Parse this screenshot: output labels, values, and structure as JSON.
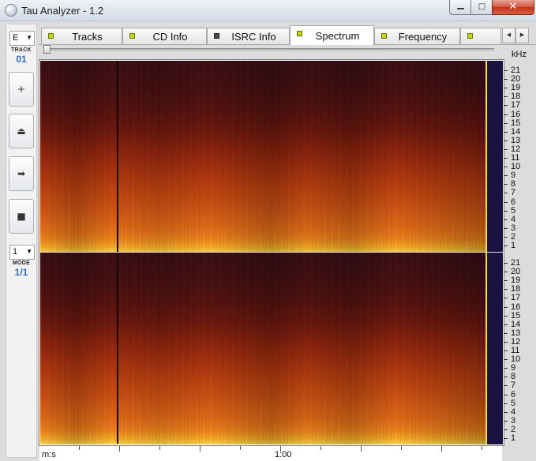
{
  "window": {
    "title": "Tau Analyzer - 1.2",
    "controls": {
      "minimize_glyph": "▁",
      "maximize_glyph": "□",
      "close_glyph": "✕"
    }
  },
  "sidebar": {
    "track_combo_value": "E",
    "track_label": "TRACK",
    "track_number": "01",
    "buttons": [
      {
        "name": "add-button",
        "glyph": "+"
      },
      {
        "name": "eject-button",
        "glyph": "⏏"
      },
      {
        "name": "next-button",
        "glyph": "➡"
      },
      {
        "name": "stop-button",
        "glyph": "■"
      }
    ],
    "mode_combo_value": "1",
    "mode_label": "MODE",
    "mode_value": "1/1"
  },
  "tabs": [
    {
      "label": "Tracks",
      "mark": "yellow-green"
    },
    {
      "label": "CD Info",
      "mark": "yellow-green"
    },
    {
      "label": "ISRC Info",
      "mark": "dark"
    },
    {
      "label": "Spectrum",
      "mark": "yellow-green",
      "active": true
    },
    {
      "label": "Frequency",
      "mark": "yellow-green"
    },
    {
      "label": "",
      "mark": "yellow-green"
    }
  ],
  "tab_scroll": {
    "left": "◀",
    "right": "▶"
  },
  "spectrum": {
    "unit_label": "kHz",
    "frequency_ticks": [
      "21",
      "20",
      "19",
      "18",
      "17",
      "16",
      "15",
      "14",
      "13",
      "12",
      "11",
      "10",
      "9",
      "8",
      "7",
      "6",
      "5",
      "4",
      "3",
      "2",
      "1"
    ],
    "time_axis": {
      "unit_label": "m:s",
      "marker_label": "1:00"
    },
    "channels": 2,
    "colors": {
      "high": "#ffe15a",
      "mid": "#e96f19",
      "low": "#3c0e15",
      "silence": "#1a1240"
    }
  }
}
